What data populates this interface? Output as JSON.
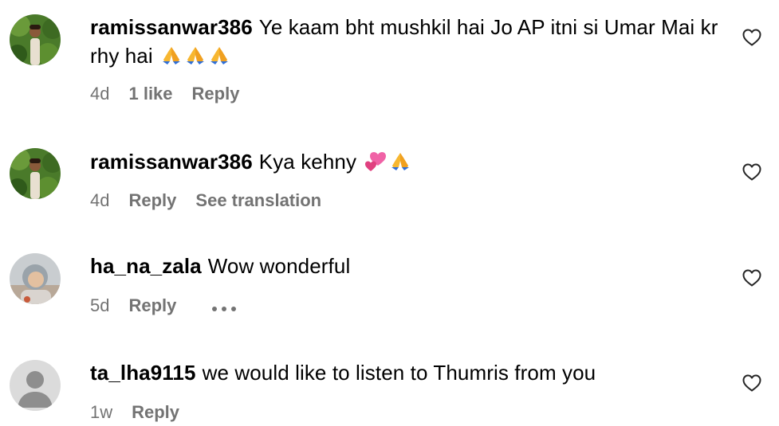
{
  "comments": [
    {
      "username": "ramissanwar386",
      "text": "Ye kaam bht mushkil hai Jo AP itni si Umar Mai kr rhy hai",
      "emojis": [
        "folded-hands",
        "folded-hands",
        "folded-hands"
      ],
      "time": "4d",
      "likes": "1 like",
      "reply": "Reply",
      "avatar": "profile-photo-man-in-garden"
    },
    {
      "username": "ramissanwar386",
      "text": "Kya kehny",
      "emojis": [
        "two-hearts",
        "folded-hands"
      ],
      "time": "4d",
      "reply": "Reply",
      "translate": "See translation",
      "avatar": "profile-photo-man-in-garden"
    },
    {
      "username": "ha_na_zala",
      "text": "Wow wonderful",
      "time": "5d",
      "reply": "Reply",
      "more": "more-options",
      "avatar": "profile-photo-child"
    },
    {
      "username": "ta_lha9115",
      "text": "we would like to listen to Thumris from you",
      "time": "1w",
      "reply": "Reply",
      "avatar": "default-avatar"
    }
  ],
  "colors": {
    "text": "#000000",
    "meta": "#737373",
    "heart_outline": "#262626",
    "default_avatar_bg": "#dbdbdb",
    "default_avatar_fg": "#8e8e8e"
  }
}
